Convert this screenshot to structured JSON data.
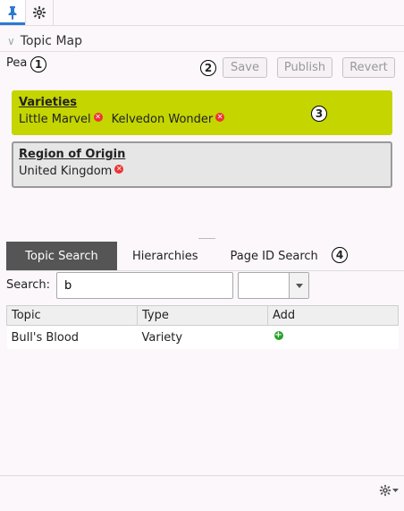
{
  "toolbar": {
    "pin_icon": "pin-icon",
    "settings_icon": "gear-icon"
  },
  "panel": {
    "title": "Topic Map"
  },
  "topic": {
    "name": "Pea"
  },
  "callouts": [
    "1",
    "2",
    "3",
    "4"
  ],
  "actions": {
    "save": "Save",
    "publish": "Publish",
    "revert": "Revert"
  },
  "cards": [
    {
      "title": "Varieties",
      "values": [
        "Little Marvel",
        "Kelvedon Wonder"
      ]
    },
    {
      "title": "Region of Origin",
      "values": [
        "United Kingdom"
      ]
    }
  ],
  "tabs": [
    "Topic Search",
    "Hierarchies",
    "Page ID Search"
  ],
  "search": {
    "label": "Search:",
    "value": "b",
    "type_value": ""
  },
  "results": {
    "headers": [
      "Topic",
      "Type",
      "Add"
    ],
    "rows": [
      {
        "topic": "Bull's Blood",
        "type": "Variety"
      }
    ]
  },
  "colors": {
    "accent": "#2a7ad2",
    "green_card": "#c4d500",
    "tab_active": "#555555",
    "remove": "#ee3333",
    "add": "#27a327"
  }
}
